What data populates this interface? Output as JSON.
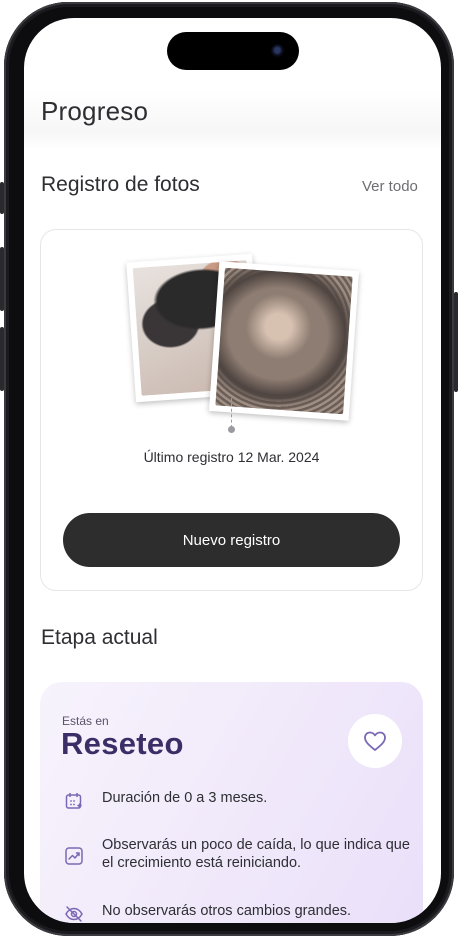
{
  "header": {
    "title": "Progreso"
  },
  "photos": {
    "section_title": "Registro de fotos",
    "see_all": "Ver todo",
    "last_record": "Último registro 12 Mar. 2024",
    "new_record_button": "Nuevo registro"
  },
  "stage": {
    "section_title": "Etapa actual",
    "subtitle": "Estás en",
    "name": "Reseteo",
    "items": [
      {
        "icon": "calendar-icon",
        "text": "Duración de 0 a 3 meses."
      },
      {
        "icon": "growth-chart-icon",
        "text": "Observarás un poco de caída, lo que indica que el crecimiento está reiniciando."
      },
      {
        "icon": "eye-off-icon",
        "text": "No observarás otros cambios grandes."
      }
    ]
  },
  "colors": {
    "accent": "#3b2e66",
    "button": "#2d2d2d",
    "stage_bg": "#efe7fa"
  }
}
